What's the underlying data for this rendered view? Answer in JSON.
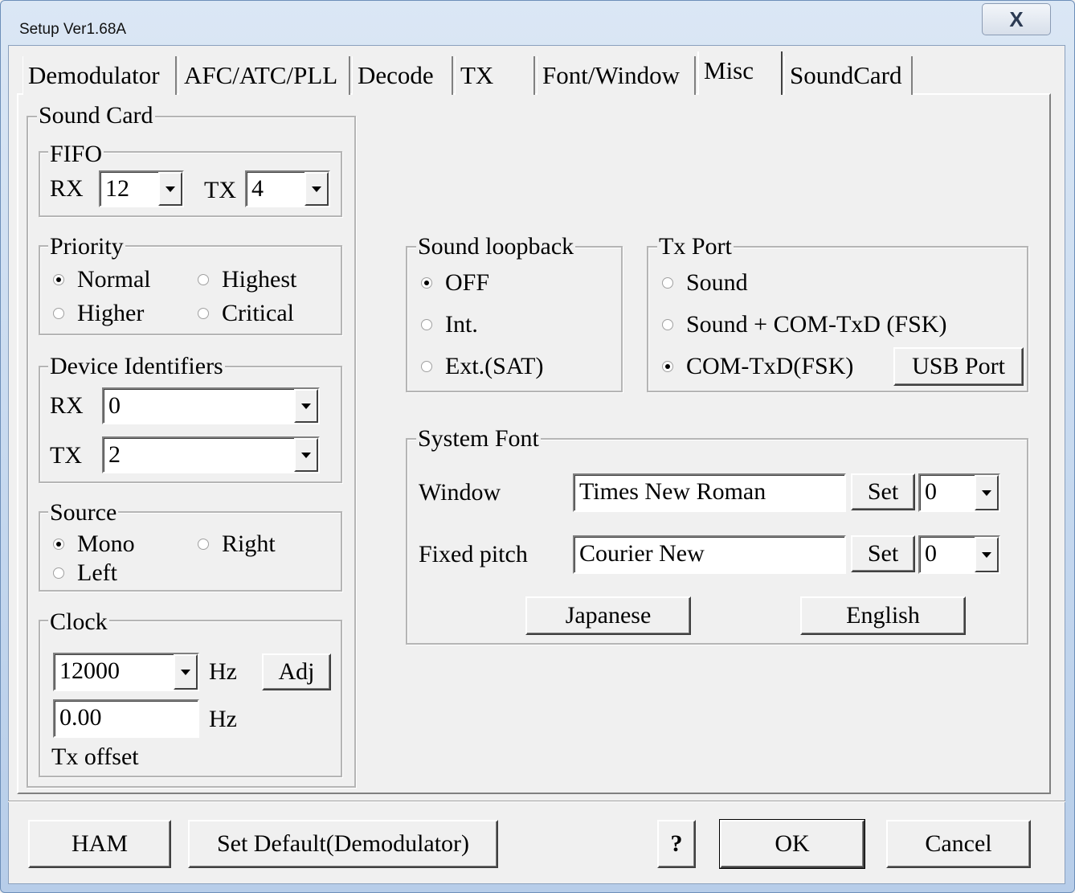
{
  "window": {
    "title": "Setup Ver1.68A",
    "close_label": "X"
  },
  "tabs": [
    {
      "label": "Demodulator"
    },
    {
      "label": "AFC/ATC/PLL"
    },
    {
      "label": "Decode"
    },
    {
      "label": "TX"
    },
    {
      "label": "Font/Window"
    },
    {
      "label": "Misc"
    },
    {
      "label": "SoundCard"
    }
  ],
  "sound_card": {
    "title": "Sound Card",
    "fifo": {
      "title": "FIFO",
      "rx_label": "RX",
      "rx_value": "12",
      "tx_label": "TX",
      "tx_value": "4"
    },
    "priority": {
      "title": "Priority",
      "options": [
        "Normal",
        "Highest",
        "Higher",
        "Critical"
      ],
      "selected": "Normal"
    },
    "device_identifiers": {
      "title": "Device Identifiers",
      "rx_label": "RX",
      "rx_value": "0",
      "tx_label": "TX",
      "tx_value": "2"
    },
    "source": {
      "title": "Source",
      "options": [
        "Mono",
        "Right",
        "Left"
      ],
      "selected": "Mono"
    },
    "clock": {
      "title": "Clock",
      "value": "12000",
      "unit": "Hz",
      "adj_label": "Adj",
      "offset_value": "0.00",
      "offset_unit": "Hz",
      "offset_label": "Tx offset"
    }
  },
  "sound_loopback": {
    "title": "Sound loopback",
    "options": [
      "OFF",
      "Int.",
      "Ext.(SAT)"
    ],
    "selected": "OFF"
  },
  "tx_port": {
    "title": "Tx Port",
    "options": [
      "Sound",
      "Sound + COM-TxD (FSK)",
      "COM-TxD(FSK)"
    ],
    "selected": "COM-TxD(FSK)",
    "usb_port_label": "USB Port"
  },
  "system_font": {
    "title": "System Font",
    "window_label": "Window",
    "window_font": "Times New Roman",
    "window_size": "0",
    "fixed_label": "Fixed pitch",
    "fixed_font": "Courier New",
    "fixed_size": "0",
    "set_label": "Set",
    "japanese_label": "Japanese",
    "english_label": "English"
  },
  "footer": {
    "ham_label": "HAM",
    "set_default_label": "Set Default(Demodulator)",
    "help_label": "?",
    "ok_label": "OK",
    "cancel_label": "Cancel"
  }
}
